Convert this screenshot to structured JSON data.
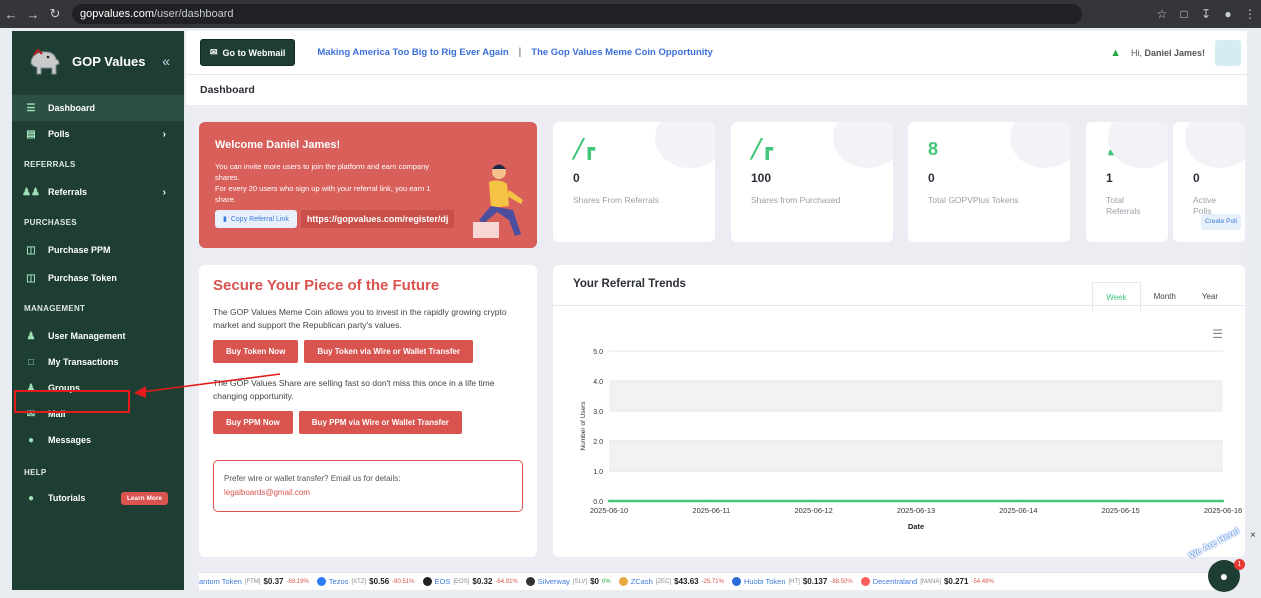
{
  "browser": {
    "url_host": "gopvalues.com",
    "url_path": "/user/dashboard"
  },
  "sidebar": {
    "brand": "GOP Values",
    "items_top": [
      {
        "label": "Dashboard",
        "icon": "dashboard-icon",
        "active": true
      },
      {
        "label": "Polls",
        "icon": "polls-icon",
        "chevron": true
      }
    ],
    "sections": [
      {
        "title": "REFERRALS",
        "items": [
          {
            "label": "Referrals",
            "icon": "users-icon",
            "chevron": true
          }
        ]
      },
      {
        "title": "PURCHASES",
        "items": [
          {
            "label": "Purchase PPM",
            "icon": "ticket-icon"
          },
          {
            "label": "Purchase Token",
            "icon": "ticket-icon"
          }
        ]
      },
      {
        "title": "MANAGEMENT",
        "items": [
          {
            "label": "User Management",
            "icon": "user-icon"
          },
          {
            "label": "My Transactions",
            "icon": "file-icon"
          },
          {
            "label": "Groups",
            "icon": "group-icon"
          },
          {
            "label": "Mail",
            "icon": "mail-icon"
          },
          {
            "label": "Messages",
            "icon": "chat-icon"
          }
        ]
      },
      {
        "title": "HELP",
        "items": [
          {
            "label": "Tutorials",
            "icon": "bulb-icon",
            "badge": "Learn More"
          }
        ]
      }
    ]
  },
  "topbar": {
    "webmail": "Go to Webmail",
    "link1": "Making America Too Big to Rig Ever Again",
    "separator": "|",
    "link2": "The Gop Values Meme Coin Opportunity",
    "greeting_prefix": "Hi,",
    "user_name": "Daniel James!"
  },
  "breadcrumb": "Dashboard",
  "welcome": {
    "title": "Welcome Daniel James!",
    "line1": "You can invite more users to join the platform and earn company shares.",
    "line2": "For every 20 users who sign up with your referral link, you earn 1 share.",
    "copy_label": "Copy Referral Link",
    "referral_link": "https://gopvalues.com/register/dj"
  },
  "stats": [
    {
      "value": "0",
      "label": "Shares From Referrals",
      "icon": "chart-icon"
    },
    {
      "value": "100",
      "label": "Shares from Purchased",
      "icon": "chart-icon"
    },
    {
      "value": "0",
      "label": "Total GOPVPlus Tokens",
      "icon": "token-icon"
    },
    {
      "value": "1",
      "label": "Total Referrals",
      "icon": "user-icon"
    },
    {
      "value": "0",
      "label": "Active Polls",
      "icon": "poll-icon",
      "button": "Create Poll"
    }
  ],
  "secure": {
    "title": "Secure Your Piece of the Future",
    "text1": "The GOP Values Meme Coin allows you to invest in the rapidly growing crypto market and support the Republican party's values.",
    "btn1": "Buy Token Now",
    "btn2": "Buy Token via Wire or Wallet Transfer",
    "text2": "The GOP Values Share are selling fast so don't miss this once in a life time changing opportunity.",
    "btn3": "Buy PPM Now",
    "btn4": "Buy PPM via Wire or Wallet Transfer",
    "email_prompt": "Prefer wire or wallet transfer? Email us for details:",
    "email": "legalboards@gmail.com"
  },
  "trend": {
    "title": "Your Referral Trends",
    "tabs": [
      "Week",
      "Month",
      "Year"
    ],
    "active_tab": "Week"
  },
  "chart_data": {
    "type": "line",
    "title": "",
    "xlabel": "Date",
    "ylabel": "Number of Users",
    "x": [
      "2025-06-10",
      "2025-06-11",
      "2025-06-12",
      "2025-06-13",
      "2025-06-14",
      "2025-06-15",
      "2025-06-16"
    ],
    "series": [
      {
        "values": [
          0,
          0,
          0,
          0,
          0,
          0,
          0
        ],
        "color": "#43c67a"
      }
    ],
    "yticks": [
      "0.0",
      "1.0",
      "2.0",
      "3.0",
      "4.0",
      "5.0"
    ],
    "ylim": [
      0,
      5
    ],
    "grid": true
  },
  "ticker": [
    {
      "name": "antom Token",
      "sym": "[FTM]",
      "price": "$0.37",
      "change": "-68.19%",
      "color": "#1969ff"
    },
    {
      "name": "Tezos",
      "sym": "[XTZ]",
      "price": "$0.56",
      "change": "-80.51%",
      "color": "#2c7df7"
    },
    {
      "name": "EOS",
      "sym": "[EOS]",
      "price": "$0.32",
      "change": "-64.91%",
      "color": "#222222"
    },
    {
      "name": "Silverway",
      "sym": "[SLV]",
      "price": "$0",
      "change": "0%",
      "color": "#333333"
    },
    {
      "name": "ZCash",
      "sym": "[ZEC]",
      "price": "$43.63",
      "change": "-25.71%",
      "color": "#e5a93d"
    },
    {
      "name": "Huobi Token",
      "sym": "[HT]",
      "price": "$0.137",
      "change": "-88.50%",
      "color": "#2a6bd8"
    },
    {
      "name": "Decentraland",
      "sym": "[MANA]",
      "price": "$0.271",
      "change": "-54.49%",
      "color": "#ff5b5b"
    }
  ],
  "chat": {
    "label": "We Are Here!",
    "count": "1"
  }
}
